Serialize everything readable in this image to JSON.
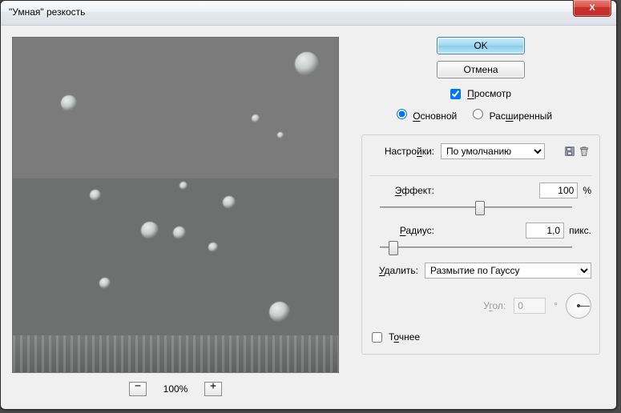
{
  "window": {
    "title": "\"Умная\" резкость",
    "close_tooltip": "Закрыть"
  },
  "buttons": {
    "ok": "OK",
    "cancel": "Отмена"
  },
  "preview": {
    "checkbox_label": "Просмотр",
    "checked": true,
    "zoom_level": "100%"
  },
  "mode": {
    "basic_label": "Основной",
    "advanced_label": "Расширенный",
    "selected": "basic"
  },
  "settings": {
    "label": "Настройки:",
    "value": "По умолчанию",
    "options": [
      "По умолчанию"
    ],
    "save_tooltip": "Сохранить копию текущих настроек",
    "delete_tooltip": "Удалить текущие настройки"
  },
  "amount": {
    "label": "Эффект:",
    "value": "100",
    "unit": "%",
    "slider_pos": 0.52
  },
  "radius": {
    "label": "Радиус:",
    "value": "1,0",
    "unit": "пикс.",
    "slider_pos": 0.05
  },
  "remove": {
    "label": "Удалить:",
    "value": "Размытие по Гауссу",
    "options": [
      "Размытие по Гауссу"
    ]
  },
  "angle": {
    "label": "Угол:",
    "value": "0",
    "enabled": false
  },
  "more_accurate": {
    "label": "Точнее",
    "checked": false
  }
}
